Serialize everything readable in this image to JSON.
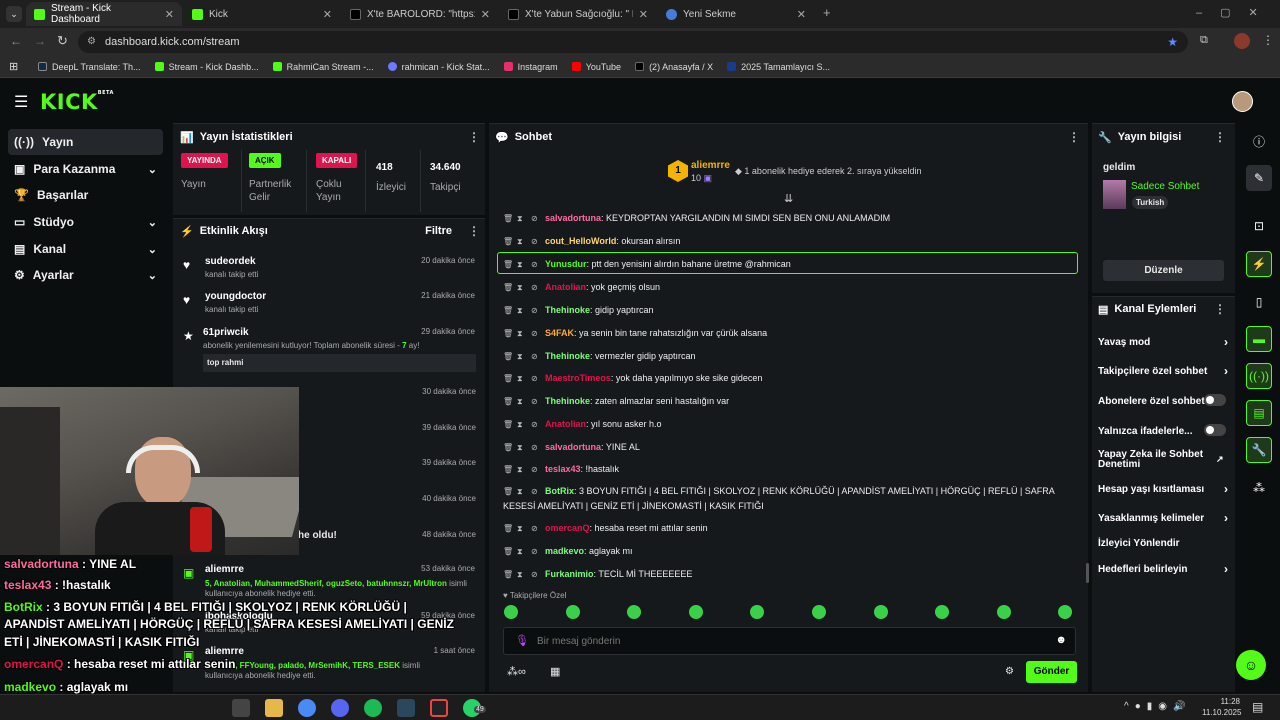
{
  "browser": {
    "tabs": [
      {
        "title": "Stream - Kick Dashboard",
        "icon": "kick-icon",
        "active": true
      },
      {
        "title": "Kick",
        "icon": "kick-icon",
        "active": false
      },
      {
        "title": "X'te BAROLORD: \"https://t.co/w",
        "icon": "x-icon",
        "active": false
      },
      {
        "title": "X'te Yabun Sağcıoğlu: \" KN",
        "icon": "x-icon",
        "active": false
      },
      {
        "title": "Yeni Sekme",
        "icon": "chrome-icon",
        "active": false
      }
    ],
    "url": "dashboard.kick.com/stream",
    "bookmarks": [
      {
        "label": "DeepL Translate: Th...",
        "icon": "deepl-icon",
        "color": "#0f2b46"
      },
      {
        "label": "Stream - Kick Dashb...",
        "icon": "kick-icon",
        "color": "#53fc18"
      },
      {
        "label": "RahmiCan Stream -...",
        "icon": "kick-icon",
        "color": "#53fc18"
      },
      {
        "label": "rahmican - Kick Stat...",
        "icon": "stats-icon",
        "color": "#6b7bff"
      },
      {
        "label": "Instagram",
        "icon": "instagram-icon",
        "color": "#e1306c"
      },
      {
        "label": "YouTube",
        "icon": "youtube-icon",
        "color": "#ff0000"
      },
      {
        "label": "(2) Anasayfa / X",
        "icon": "x-icon",
        "color": "#000000"
      },
      {
        "label": "2025 Tamamlayıcı S...",
        "icon": "doc-icon",
        "color": "#1a3a8a"
      }
    ]
  },
  "kick": {
    "logo": "KICK",
    "beta": "BETA"
  },
  "sidebar": {
    "items": [
      {
        "label": "Yayın",
        "icon": "stream-icon",
        "chevron": false,
        "active": true
      },
      {
        "label": "Para Kazanma",
        "icon": "money-icon",
        "chevron": true
      },
      {
        "label": "Başarılar",
        "icon": "trophy-icon",
        "chevron": false
      },
      {
        "label": "Stüdyo",
        "icon": "studio-icon",
        "chevron": true
      },
      {
        "label": "Kanal",
        "icon": "channel-icon",
        "chevron": true
      },
      {
        "label": "Ayarlar",
        "icon": "settings-icon",
        "chevron": true
      }
    ]
  },
  "stats": {
    "title": "Yayın İstatistikleri",
    "cols": [
      {
        "badge": "YAYINDA",
        "badge_color": "#e0144c",
        "label": "Yayın"
      },
      {
        "badge": "AÇIK",
        "badge_color": "#53fc18",
        "label": "Partnerlik Gelir"
      },
      {
        "badge": "KAPALI",
        "badge_color": "#e0144c",
        "label": "Çoklu Yayın"
      },
      {
        "value": "418",
        "label": "İzleyici"
      },
      {
        "value": "34.640",
        "label": "Takipçi"
      }
    ]
  },
  "activity": {
    "title": "Etkinlik Akışı",
    "filter": "Filtre",
    "events": [
      {
        "name": "sudeordek",
        "sub": "kanalı takip etti",
        "time": "20 dakika önce",
        "icon": "heart-icon"
      },
      {
        "name": "youngdoctor",
        "sub": "kanalı takip etti",
        "time": "21 dakika önce",
        "icon": "heart-icon"
      },
      {
        "name": "61priwcik",
        "sub": "abonelik yenilemesini kutluyor! Toplam abonelik süresi - ",
        "sub_highlight": "7",
        "sub_tail": " ay!",
        "msg": "top rahmi",
        "time": "29 dakika önce",
        "icon": "star-icon"
      }
    ],
    "hidden_times": [
      "30 dakika önce",
      "39 dakika önce",
      "39 dakika önce",
      "40 dakika önce",
      "48 dakika önce"
    ],
    "partial_text": "he oldu!",
    "gifts": [
      {
        "name": "aliemrre",
        "time": "53 dakika önce",
        "names": "5, Anatolian, MuhammedSherif, oguzSeto, batuhnnszr, MrUltron",
        "sub1": " isimli",
        "sub2": "kullanıcıya abonelik hediye etti."
      },
      {
        "name": "ibohaskologlu",
        "time": "59 dakika önce",
        "sub": "kanalı takip etti"
      },
      {
        "name": "aliemrre",
        "time": "1 saat önce",
        "names": "kanimio, FFYoung, palado, MrSemihK, TERS_ESEK",
        "sub1": " isimli",
        "sub2": "kullanıcıya abonelik hediye etti."
      }
    ]
  },
  "chat": {
    "title": "Sohbet",
    "pinned": {
      "rank": "1",
      "name": "aliemrre",
      "count": "10",
      "text": "1 abonelik hediye ederek 2. sıraya yükseldin"
    },
    "messages": [
      {
        "user": "salvadortuna",
        "color": "#ff6b9d",
        "text": ": KEYDROPTAN YARGILANDIN MI SIMDI SEN BEN ONU ANLAMADIM"
      },
      {
        "user": "cout_HelloWorld",
        "color": "#ffd66b",
        "text": ": okursan alırsın"
      },
      {
        "user": "Yunusdur",
        "color": "#53fc18",
        "text": ": ptt den yenisini alırdın bahane üretme @rahmican",
        "highlight": true
      },
      {
        "user": "Anatolian",
        "color": "#e0144c",
        "text": ": yok geçmiş olsun"
      },
      {
        "user": "Thehinoke",
        "color": "#7cfc7c",
        "text": ": gidip yaptırcan"
      },
      {
        "user": "S4FAK",
        "color": "#ffaa33",
        "text": ": ya senin bin tane rahatsızlığın var çürük alsana"
      },
      {
        "user": "Thehinoke",
        "color": "#7cfc7c",
        "text": ": vermezler gidip yaptırcan"
      },
      {
        "user": "MaestroTimeos",
        "color": "#e0144c",
        "text": ": yok daha yapılmıyo ske sike gidecen"
      },
      {
        "user": "Thehinoke",
        "color": "#7cfc7c",
        "text": ": zaten almazlar seni hastalığın var"
      },
      {
        "user": "Anatolian",
        "color": "#e0144c",
        "text": ": yıl sonu asker h.o"
      },
      {
        "user": "salvadortuna",
        "color": "#ff6b9d",
        "text": ": YINE AL"
      },
      {
        "user": "teslax43",
        "color": "#ff6b9d",
        "text": ": !hastalık"
      },
      {
        "user": "BotRix",
        "color": "#7cfc7c",
        "text": ": 3 BOYUN FITIĞI | 4 BEL FITIĞI | SKOLYOZ | RENK KÖRLÜĞÜ | APANDİST AMELİYATI | HÖRGÜÇ | REFLÜ | SAFRA",
        "text2": "KESESİ AMELİYATI | GENİZ ETİ | JİNEKOMASTİ | KASIK FITIĞI"
      },
      {
        "user": "omercanQ",
        "color": "#e0144c",
        "text": ": hesaba reset mi attılar senin"
      },
      {
        "user": "madkevo",
        "color": "#7cfc7c",
        "text": ": aglayak mı"
      },
      {
        "user": "Furkanimio",
        "color": "#7cfc7c",
        "text": ": TECİL Mİ THEEEEEEE"
      }
    ],
    "followers_only": "Takipçilere Özel",
    "input_placeholder": "Bir mesaj gönderin",
    "send": "Gönder"
  },
  "stream_info": {
    "title": "Yayın bilgisi",
    "stream_title": "geldim",
    "category": "Sadece Sohbet",
    "language": "Turkish",
    "edit": "Düzenle"
  },
  "channel_actions": {
    "title": "Kanal Eylemleri",
    "items": [
      {
        "label": "Yavaş mod",
        "type": "chevron"
      },
      {
        "label": "Takipçilere özel sohbet",
        "type": "chevron"
      },
      {
        "label": "Abonelere özel sohbet",
        "type": "toggle"
      },
      {
        "label": "Yalnızca ifadelerle...",
        "type": "toggle"
      },
      {
        "label": "Yapay Zeka ile Sohbet Denetimi",
        "type": "external"
      },
      {
        "label": "Hesap yaşı kısıtlaması",
        "type": "chevron"
      },
      {
        "label": "Yasaklanmış kelimeler",
        "type": "chevron"
      },
      {
        "label": "İzleyici Yönlendir",
        "type": "none"
      },
      {
        "label": "Hedefleri belirleyin",
        "type": "chevron"
      }
    ]
  },
  "overlay": {
    "lines": [
      {
        "user": "salvadortuna",
        "color": "#ff6b9d",
        "text": " : YINE AL"
      },
      {
        "user": "teslax43",
        "color": "#ff6b9d",
        "text": " : !hastalık"
      },
      {
        "user": "BotRix",
        "color": "#53fc18",
        "text": " : 3 BOYUN FITIĞI | 4 BEL FITIĞI | SKOLYOZ | RENK KÖRLÜĞÜ |"
      },
      {
        "user": "",
        "color": "#fff",
        "text": "APANDİST AMELİYATI | HÖRGÜÇ | REFLÜ | SAFRA KESESİ AMELİYATI | GENİZ"
      },
      {
        "user": "",
        "color": "#fff",
        "text": "ETİ | JİNEKOMASTİ | KASIK FITIĞI"
      },
      {
        "user": "omercanQ",
        "color": "#e0144c",
        "text": " : hesaba reset mi attılar senin"
      },
      {
        "user": "madkevo",
        "color": "#53fc18",
        "text": " : aglayak mı"
      },
      {
        "user": "Furkanimio",
        "color": "#53fc18",
        "text": " : TECİL Mİ THEEEEEEE"
      }
    ]
  },
  "taskbar": {
    "time": "11:28",
    "date": "11.10.2025",
    "badge": "49"
  }
}
